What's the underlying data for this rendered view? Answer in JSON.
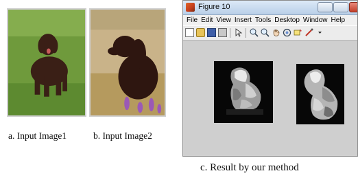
{
  "figure_window": {
    "title": "Figure 10",
    "menus": [
      "File",
      "Edit",
      "View",
      "Insert",
      "Tools",
      "Desktop",
      "Window",
      "Help"
    ]
  },
  "toolbar_icons": [
    "new-file-icon",
    "open-folder-icon",
    "save-icon",
    "print-icon",
    "arrow-cursor-icon",
    "zoom-in-icon",
    "zoom-out-icon",
    "pan-hand-icon",
    "rotate-3d-icon",
    "data-cursor-icon",
    "brush-icon"
  ],
  "captions": {
    "a": "a. Input Image1",
    "b": "b. Input Image2",
    "c": "c. Result  by our method"
  }
}
